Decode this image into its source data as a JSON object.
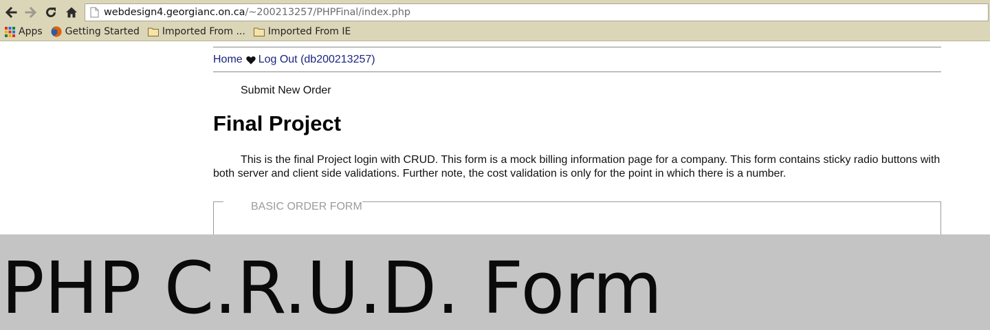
{
  "browser": {
    "url_host": "webdesign4.georgianc.on.ca",
    "url_path": "/~200213257/PHPFinal/index.php",
    "bookmarks": [
      {
        "label": "Apps",
        "icon": "apps-grid-icon"
      },
      {
        "label": "Getting Started",
        "icon": "firefox-icon"
      },
      {
        "label": "Imported From ...",
        "icon": "folder-icon"
      },
      {
        "label": "Imported From IE",
        "icon": "folder-icon"
      }
    ],
    "colors": {
      "chrome": "#dcd6b8"
    }
  },
  "nav": {
    "home": "Home",
    "separator_icon": "heart-icon",
    "logout": "Log Out (db200213257)"
  },
  "page": {
    "submit_link": "Submit New Order",
    "title": "Final Project",
    "intro": "This is the final Project login with CRUD. This form is a mock billing information page for a company. This form contains sticky radio buttons with both server and client side validations. Further note, the cost validation is only for the point in which there is a number.",
    "form_legend": "BASIC ORDER FORM"
  },
  "banner": {
    "title": "PHP C.R.U.D. Form",
    "background": "#c4c4c4"
  }
}
